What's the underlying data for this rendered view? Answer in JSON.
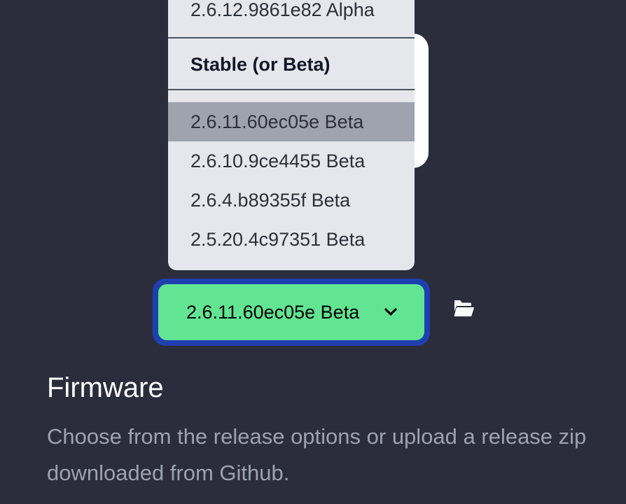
{
  "release_menu": {
    "alpha_items": [
      {
        "label": "2.6.12.9861e82 Alpha"
      }
    ],
    "stable_header": "Stable (or Beta)",
    "stable_items": [
      {
        "label": "2.6.11.60ec05e Beta",
        "highlighted": true
      },
      {
        "label": "2.6.10.9ce4455 Beta",
        "highlighted": false
      },
      {
        "label": "2.6.4.b89355f Beta",
        "highlighted": false
      },
      {
        "label": "2.5.20.4c97351 Beta",
        "highlighted": false
      }
    ]
  },
  "release_select": {
    "selected_value": "2.6.11.60ec05e Beta",
    "icon": "chevron-down-icon"
  },
  "upload_button": {
    "icon": "folder-open-icon"
  },
  "firmware_section": {
    "title": "Firmware",
    "description": "Choose from the release options or upload a release zip downloaded from Github."
  },
  "colors": {
    "background": "#2c2d3c",
    "menu_background": "#e6e7ec",
    "menu_highlight": "#9ea3ad",
    "select_background": "#62e592",
    "focus_ring": "#1e40af",
    "title_text": "#ffffff",
    "description_text": "#9ca3af"
  }
}
